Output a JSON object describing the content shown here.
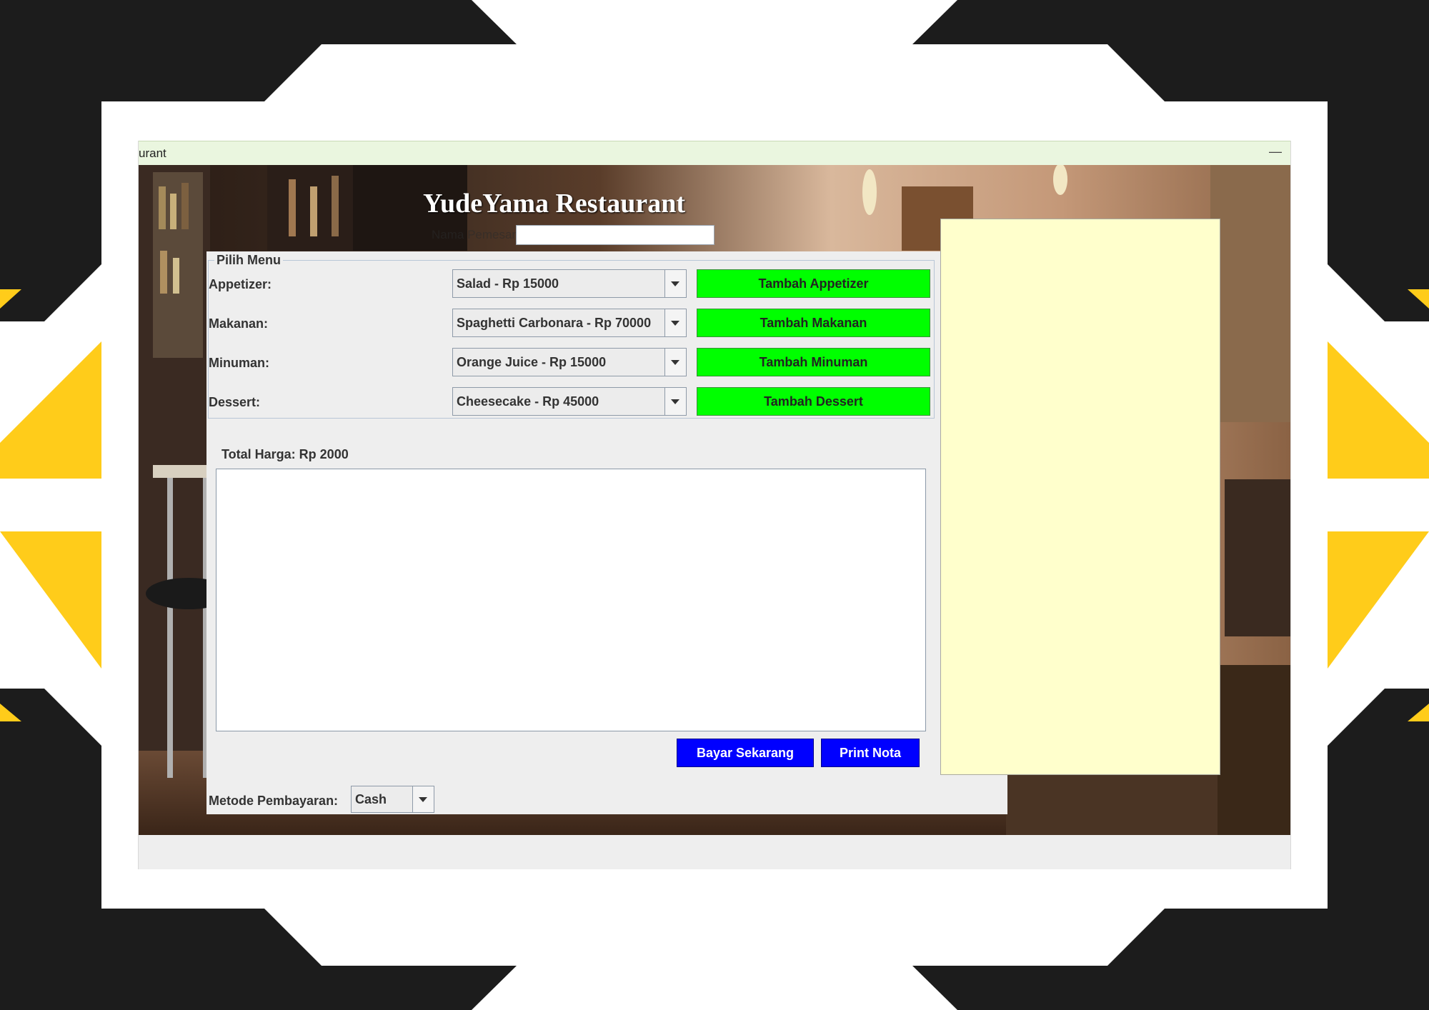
{
  "window": {
    "title": "urant",
    "minimize_icon": "minimize-icon"
  },
  "header": {
    "title": "YudeYama Restaurant",
    "name_label": "Nama Pemesan"
  },
  "menu": {
    "group_title": "Pilih Menu",
    "rows": [
      {
        "label": "Appetizer:",
        "selected": "Salad - Rp 15000",
        "button": "Tambah Appetizer"
      },
      {
        "label": "Makanan:",
        "selected": "Spaghetti Carbonara - Rp 70000",
        "button": "Tambah Makanan"
      },
      {
        "label": "Minuman:",
        "selected": "Orange Juice - Rp 15000",
        "button": "Tambah Minuman"
      },
      {
        "label": "Dessert:",
        "selected": "Cheesecake - Rp 45000",
        "button": "Tambah Dessert"
      }
    ]
  },
  "order": {
    "total_label": "Total Harga: Rp 2000",
    "pay_button": "Bayar Sekarang",
    "print_button": "Print Nota"
  },
  "payment": {
    "method_label": "Metode Pembayaran:",
    "method_value": "Cash"
  },
  "colors": {
    "add_button": "#00ff00",
    "action_button": "#0000ff",
    "receipt_panel": "#ffffcc",
    "frame_dark": "#1c1c1c",
    "frame_accent": "#ffcc1a"
  }
}
